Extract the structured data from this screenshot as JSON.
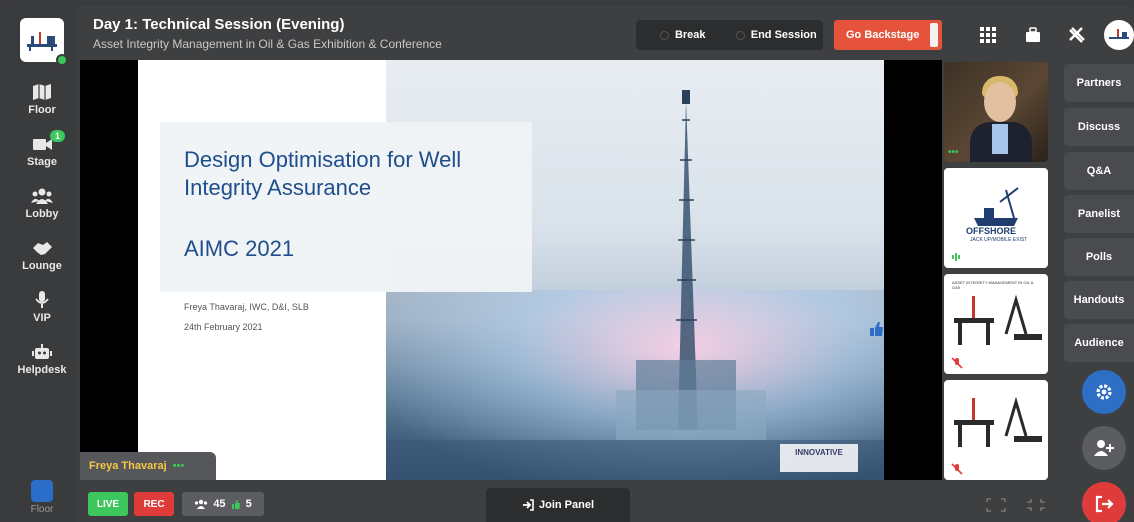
{
  "session": {
    "title": "Day 1: Technical Session (Evening)",
    "subtitle": "Asset Integrity Management in Oil & Gas Exhibition & Conference"
  },
  "controls": {
    "break_label": "Break",
    "end_session_label": "End Session",
    "backstage_label": "Go Backstage"
  },
  "nav": {
    "items": [
      {
        "label": "Floor",
        "icon": "map-icon"
      },
      {
        "label": "Stage",
        "icon": "video-camera-icon",
        "badge": "1"
      },
      {
        "label": "Lobby",
        "icon": "people-icon"
      },
      {
        "label": "Lounge",
        "icon": "handshake-icon"
      },
      {
        "label": "VIP",
        "icon": "microphone-icon"
      },
      {
        "label": "Helpdesk",
        "icon": "robot-icon"
      }
    ],
    "bottom_label": "Floor"
  },
  "slide": {
    "title": "Design Optimisation for Well Integrity Assurance",
    "event": "AIMC 2021",
    "author": "Freya Thavaraj, IWC, D&I, SLB",
    "date": "24th February 2021",
    "logo_text": "INNOVATIVE"
  },
  "presenter": {
    "name": "Freya Thavaraj"
  },
  "right_panel": {
    "items": [
      "Partners",
      "Discuss",
      "Q&A",
      "Panelist",
      "Polls",
      "Handouts",
      "Audience"
    ]
  },
  "tiles": {
    "offshore_text": "OFFSHORE",
    "offshore_sub": "JACK UP/MOBILE EXIST",
    "aimc_text": "ASSET INTEGRITY MANAGEMENT IN OIL & GAS"
  },
  "bottom": {
    "live_label": "LIVE",
    "rec_label": "REC",
    "attendees": "45",
    "likes": "5",
    "join_panel_label": "Join Panel"
  },
  "colors": {
    "accent_green": "#3cc65b",
    "backstage_red": "#e5533d",
    "rec_red": "#e03b3b",
    "settings_blue": "#2d6fc4",
    "slide_title_blue": "#1f4e8c"
  }
}
